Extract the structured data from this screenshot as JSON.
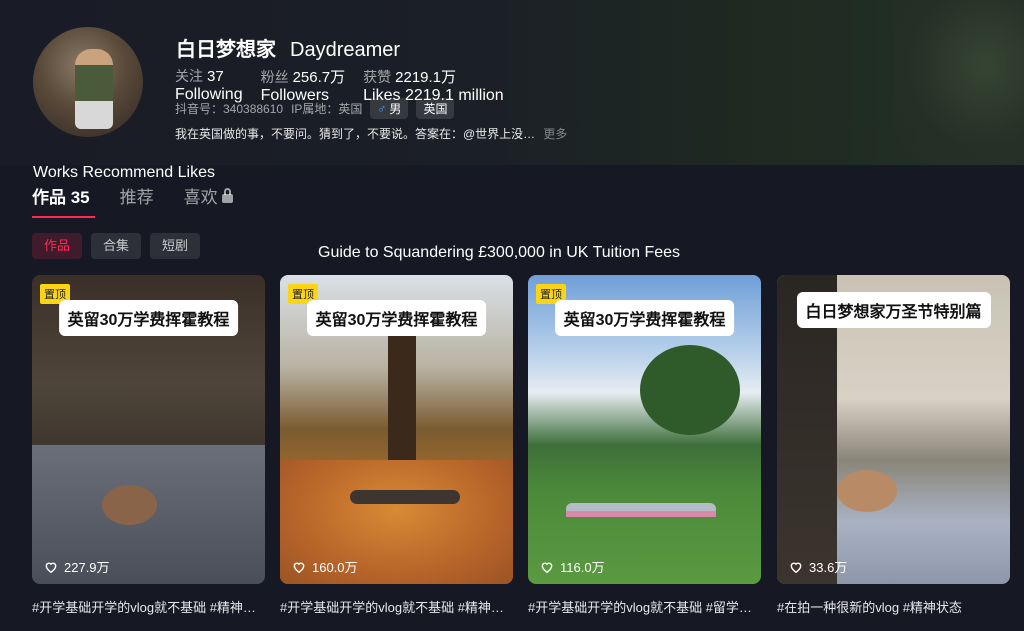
{
  "profile": {
    "name_cn": "白日梦想家",
    "name_en": "Daydreamer",
    "stats": [
      {
        "label": "关注",
        "value": "37",
        "en": "Following"
      },
      {
        "label": "粉丝",
        "value": "256.7万",
        "en": "Followers"
      },
      {
        "label": "获赞",
        "value": "2219.1万",
        "en": "Likes 2219.1 million"
      }
    ],
    "douyin_id": "抖音号：340388610",
    "ip_location": "IP属地：英国",
    "gender_tag": "男",
    "region_tag": "英国",
    "bio": "我在英国做的事，不要问。猜到了，不要说。答案在：@世界上没…",
    "more_label": "更多"
  },
  "tabs": {
    "english_label": "Works  Recommend Likes",
    "items": [
      {
        "label": "作品 35",
        "active": true
      },
      {
        "label": "推荐"
      },
      {
        "label": "喜欢"
      }
    ]
  },
  "chips": [
    "作品",
    "合集",
    "短剧"
  ],
  "overlay_caption": "Guide to Squandering £300,000 in UK Tuition Fees",
  "videos": [
    {
      "pinned": "置顶",
      "title": "英留30万学费挥霍教程",
      "likes": "227.9万",
      "desc": "#开学基础开学的vlog就不基础 #精神状态"
    },
    {
      "pinned": "置顶",
      "title": "英留30万学费挥霍教程",
      "likes": "160.0万",
      "desc": "#开学基础开学的vlog就不基础 #精神状态"
    },
    {
      "pinned": "置顶",
      "title": "英留30万学费挥霍教程",
      "likes": "116.0万",
      "desc": "#开学基础开学的vlog就不基础 #留学生活"
    },
    {
      "title": "白日梦想家万圣节特别篇",
      "likes": "33.6万",
      "desc": "#在拍一种很新的vlog #精神状态"
    }
  ],
  "colors": {
    "accent": "#fe2c55",
    "pin": "#fbd413",
    "background": "#161823"
  }
}
